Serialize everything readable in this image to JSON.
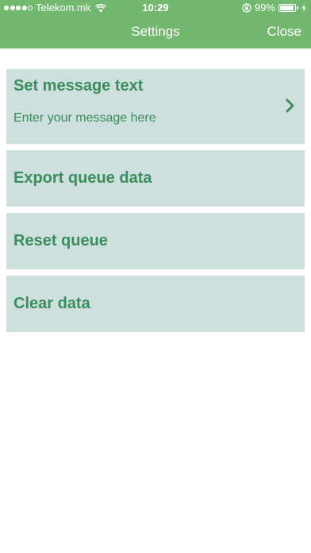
{
  "status_bar": {
    "carrier": "Telekom.mk",
    "time": "10:29",
    "battery_percent_label": "99%",
    "battery_level": 0.99,
    "signal_bars_filled": 4,
    "signal_bars_total": 5
  },
  "nav": {
    "title": "Settings",
    "close_label": "Close"
  },
  "settings": {
    "items": [
      {
        "title": "Set message text",
        "subtitle": "Enter your message here"
      },
      {
        "title": "Export queue data"
      },
      {
        "title": "Reset queue"
      },
      {
        "title": "Clear data"
      }
    ]
  },
  "colors": {
    "header_green": "#72b86f",
    "row_background": "#cde0dd",
    "row_text": "#3a8e5d"
  },
  "icons": {
    "wifi": "wifi-icon",
    "rotation_lock": "rotation-lock-icon",
    "battery": "battery-icon",
    "charging": "charging-bolt-icon",
    "disclosure": "chevron-right-icon"
  }
}
